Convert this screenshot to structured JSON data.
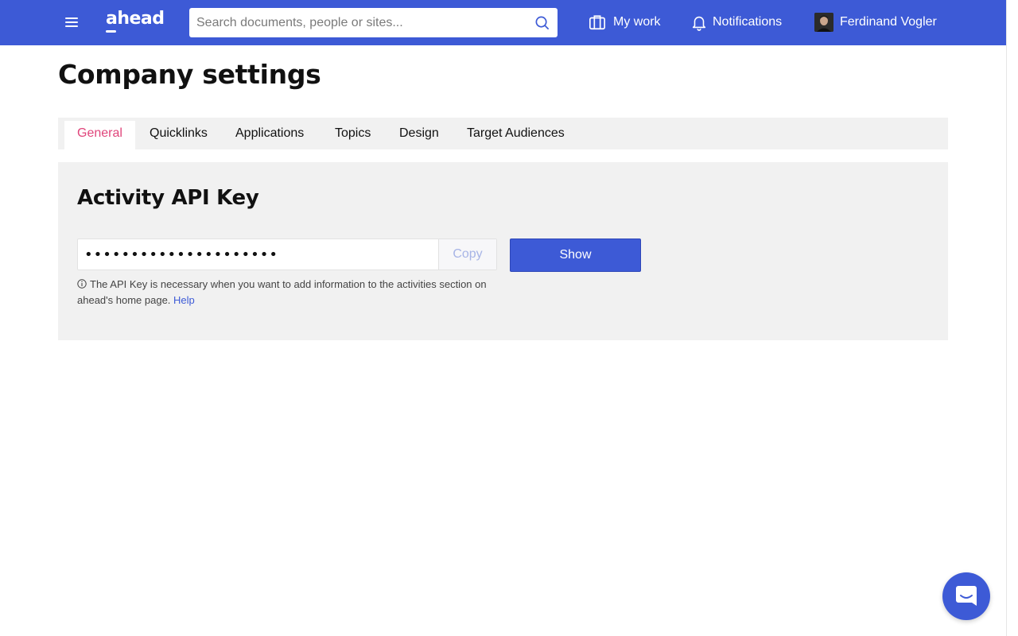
{
  "topbar": {
    "logo": "ahead",
    "search_placeholder": "Search documents, people or sites...",
    "my_work_label": "My work",
    "notifications_label": "Notifications",
    "user_name": "Ferdinand Vogler",
    "background_color": "#3d5ad6"
  },
  "page": {
    "title": "Company settings"
  },
  "tabs": [
    {
      "label": "General",
      "active": true
    },
    {
      "label": "Quicklinks",
      "active": false
    },
    {
      "label": "Applications",
      "active": false
    },
    {
      "label": "Topics",
      "active": false
    },
    {
      "label": "Design",
      "active": false
    },
    {
      "label": "Target Audiences",
      "active": false
    }
  ],
  "api_key": {
    "title": "Activity API Key",
    "masked_value": "•••••••••••••••••••••",
    "copy_label": "Copy",
    "show_label": "Show",
    "hint_text": "The API Key is necessary when you want to add information to the activities section on ahead's home page.",
    "help_link": "Help"
  },
  "icons": {
    "menu": "hamburger-menu-icon",
    "search": "search-icon",
    "my_work": "briefcase-icon",
    "notifications": "bell-icon",
    "info": "info-icon",
    "chat": "chat-icon"
  },
  "colors": {
    "accent": "#3d5ad6",
    "active_tab": "#e0457b"
  }
}
